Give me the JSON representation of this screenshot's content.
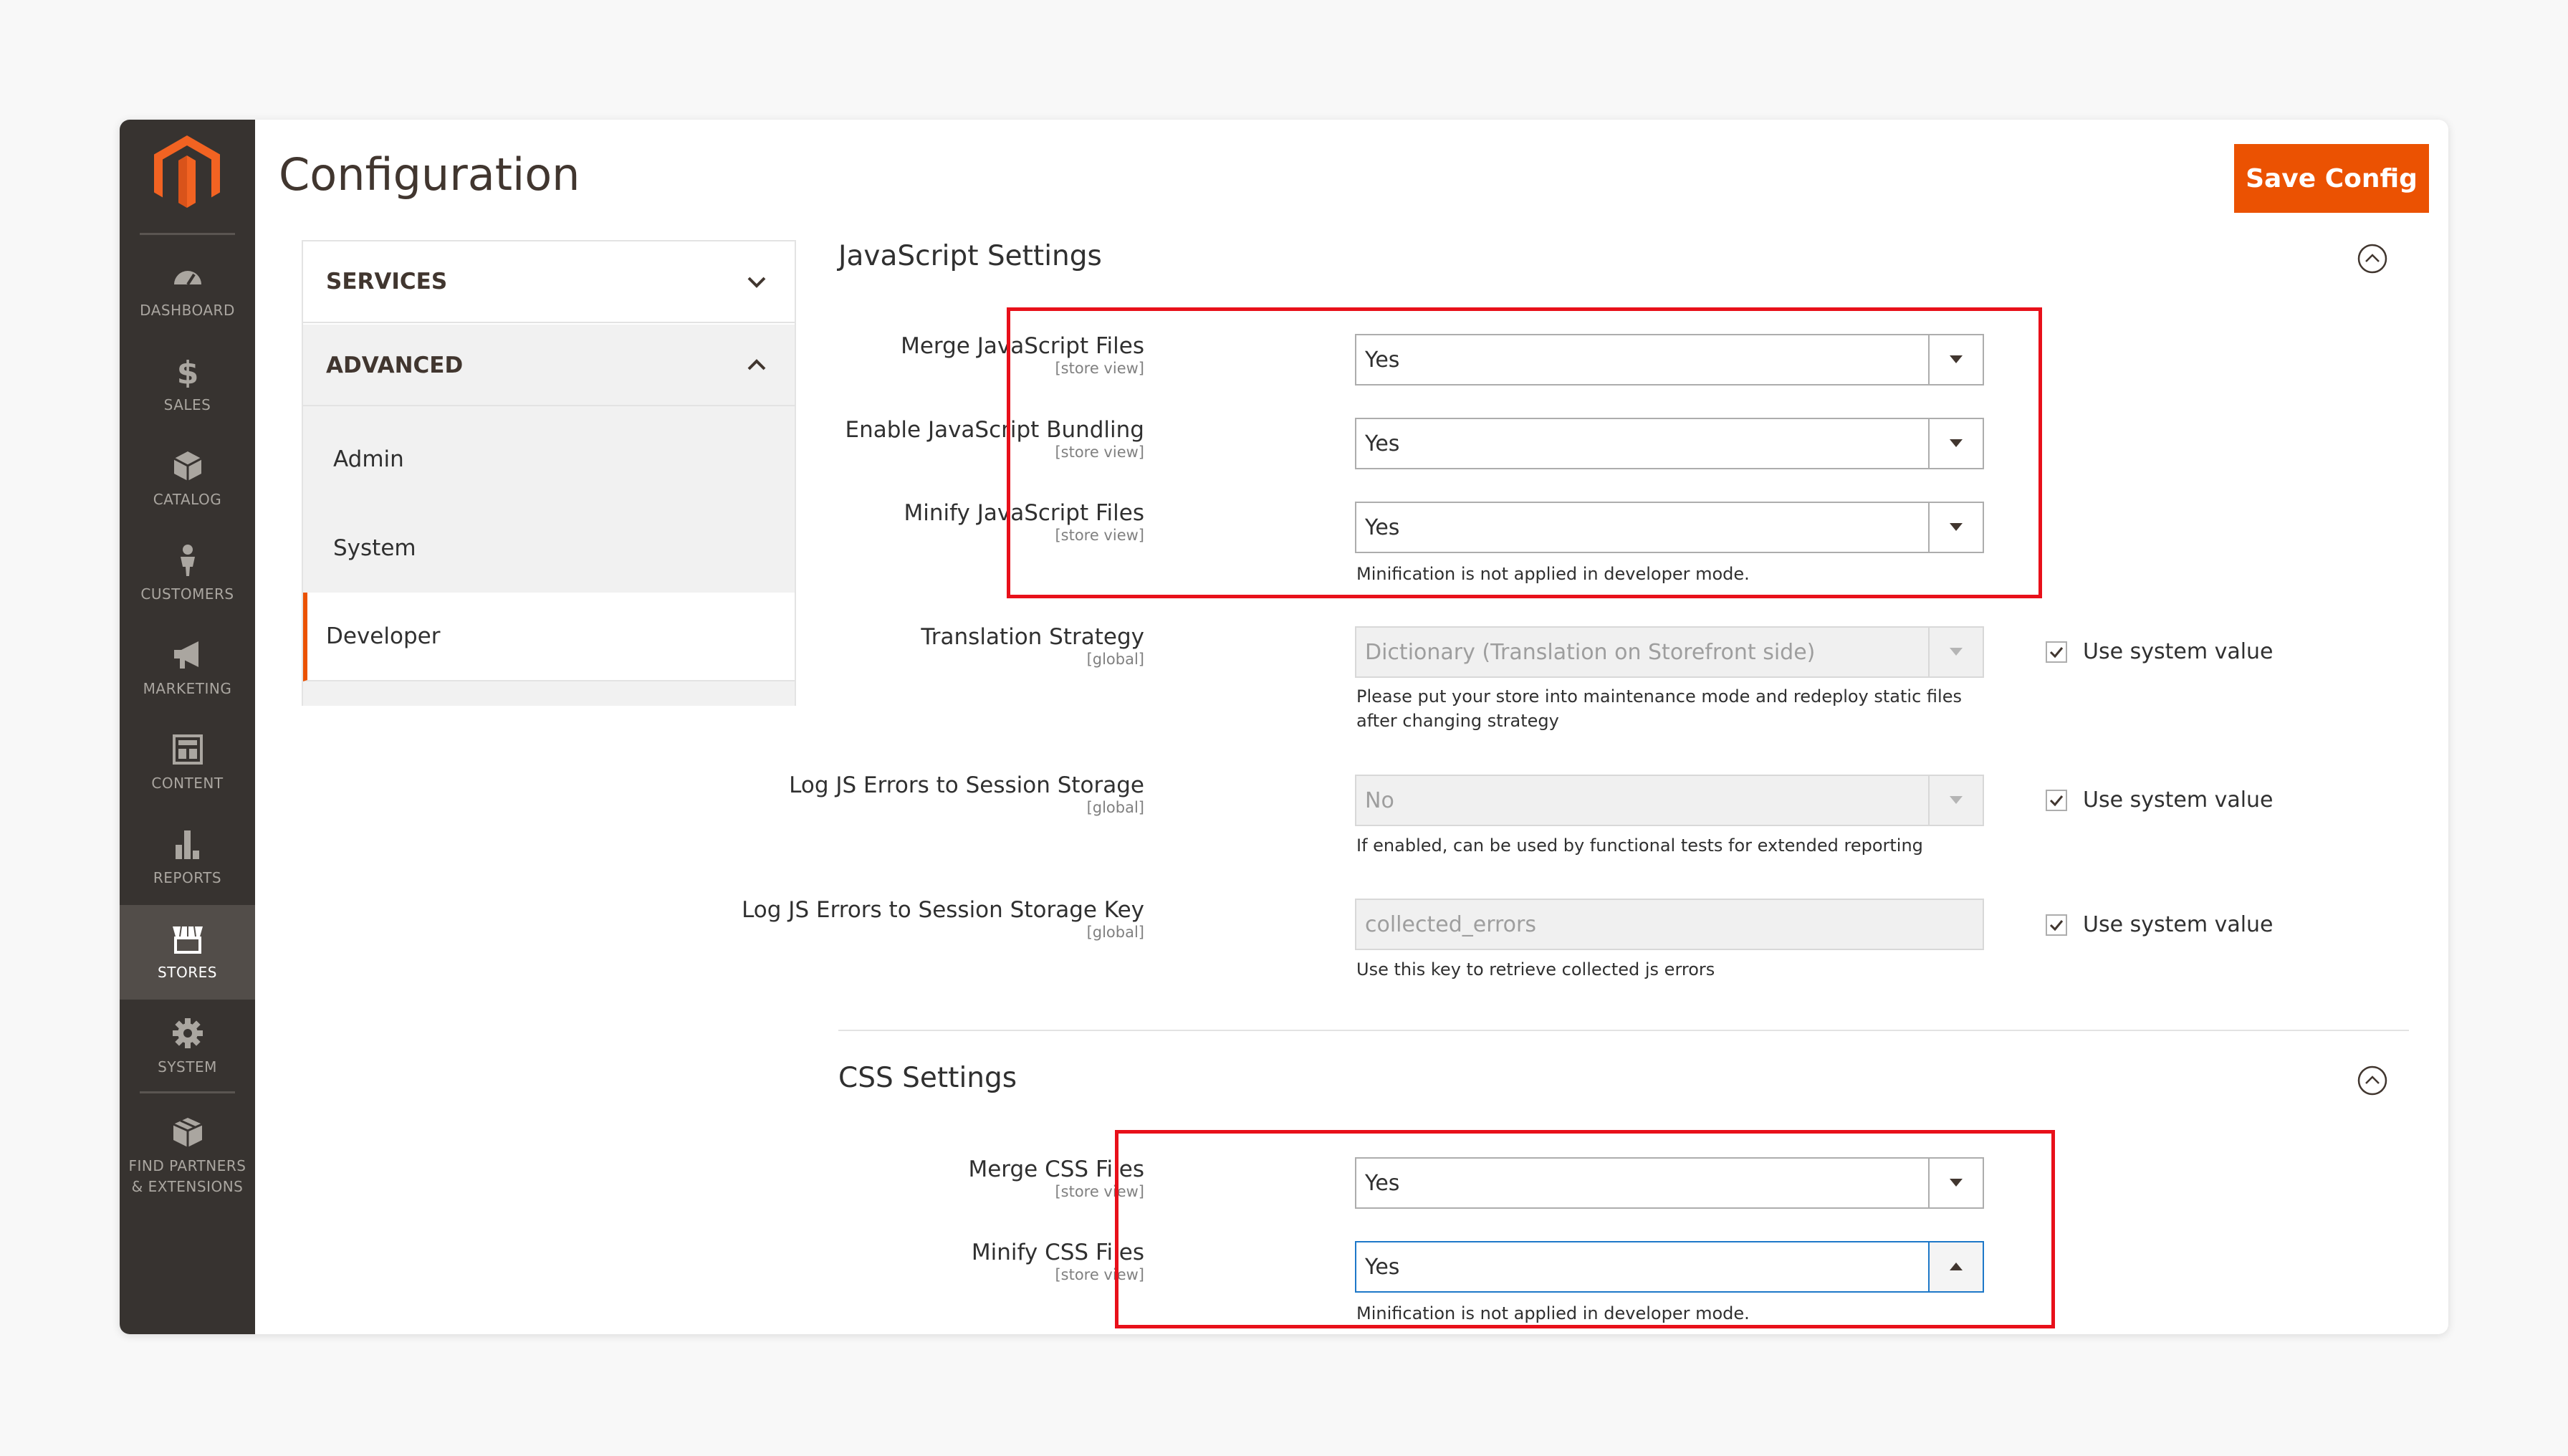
{
  "header": {
    "title": "Configuration",
    "save_label": "Save Config"
  },
  "nav": {
    "items": [
      {
        "label": "DASHBOARD",
        "icon": "dashboard-icon"
      },
      {
        "label": "SALES",
        "icon": "dollar-icon"
      },
      {
        "label": "CATALOG",
        "icon": "cube-icon"
      },
      {
        "label": "CUSTOMERS",
        "icon": "person-icon"
      },
      {
        "label": "MARKETING",
        "icon": "megaphone-icon"
      },
      {
        "label": "CONTENT",
        "icon": "layout-icon"
      },
      {
        "label": "REPORTS",
        "icon": "bar-chart-icon"
      },
      {
        "label": "STORES",
        "icon": "storefront-icon"
      },
      {
        "label": "SYSTEM",
        "icon": "gear-icon"
      },
      {
        "label": "FIND PARTNERS & EXTENSIONS",
        "icon": "box-icon"
      }
    ],
    "active": "STORES"
  },
  "tabs": {
    "services": "SERVICES",
    "advanced": "ADVANCED",
    "sub_items": [
      "Admin",
      "System",
      "Developer"
    ],
    "active_sub": "Developer"
  },
  "js_settings": {
    "title": "JavaScript Settings",
    "fields": {
      "merge": {
        "label": "Merge JavaScript Files",
        "scope": "[store view]",
        "value": "Yes"
      },
      "bundling": {
        "label": "Enable JavaScript Bundling",
        "scope": "[store view]",
        "value": "Yes"
      },
      "minify": {
        "label": "Minify JavaScript Files",
        "scope": "[store view]",
        "value": "Yes",
        "note": "Minification is not applied in developer mode."
      },
      "translation": {
        "label": "Translation Strategy",
        "scope": "[global]",
        "value": "Dictionary (Translation on Storefront side)",
        "note_line1": "Please put your store into maintenance mode and redeploy static files",
        "note_line2": "after changing strategy",
        "system_value": "Use system value"
      },
      "log_errors": {
        "label": "Log JS Errors to Session Storage",
        "scope": "[global]",
        "value": "No",
        "note": "If enabled, can be used by functional tests for extended reporting",
        "system_value": "Use system value"
      },
      "log_key": {
        "label": "Log JS Errors to Session Storage Key",
        "scope": "[global]",
        "value": "collected_errors",
        "note": "Use this key to retrieve collected js errors",
        "system_value": "Use system value"
      }
    }
  },
  "css_settings": {
    "title": "CSS Settings",
    "fields": {
      "merge": {
        "label": "Merge CSS Files",
        "scope": "[store view]",
        "value": "Yes"
      },
      "minify": {
        "label": "Minify CSS Files",
        "scope": "[store view]",
        "value": "Yes",
        "note": "Minification is not applied in developer mode."
      }
    }
  },
  "colors": {
    "accent": "#eb5202",
    "nav_bg": "#373330",
    "highlight": "#e8101a",
    "focus": "#1e78c8"
  }
}
